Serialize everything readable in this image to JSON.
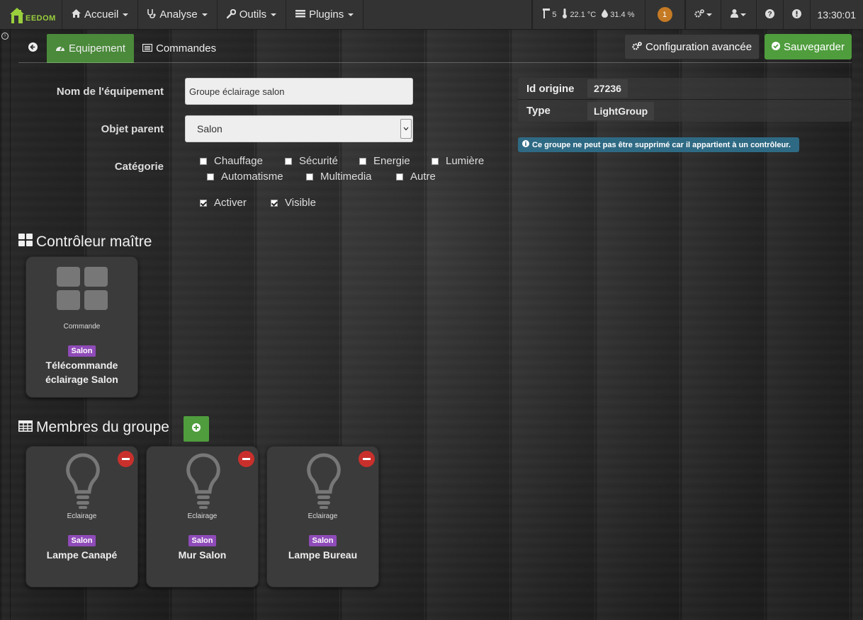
{
  "navbar": {
    "brand": "EEDOM",
    "menu": [
      {
        "label": "Accueil",
        "icon": "home-icon"
      },
      {
        "label": "Analyse",
        "icon": "stethoscope-icon"
      },
      {
        "label": "Outils",
        "icon": "wrench-icon"
      },
      {
        "label": "Plugins",
        "icon": "tasks-icon"
      }
    ],
    "status": {
      "doors": "5",
      "temperature": "22.1 °C",
      "humidity": "31.4 %"
    },
    "notifications": "1",
    "clock": "13:30:01"
  },
  "tabs": {
    "equipment": "Equipement",
    "commands": "Commandes"
  },
  "actions": {
    "advanced": "Configuration avancée",
    "save": "Sauvegarder"
  },
  "form": {
    "name_label": "Nom de l'équipement",
    "name_value": "Groupe éclairage salon",
    "parent_label": "Objet parent",
    "parent_value": "Salon",
    "category_label": "Catégorie",
    "categories": [
      {
        "label": "Chauffage",
        "checked": false
      },
      {
        "label": "Sécurité",
        "checked": false
      },
      {
        "label": "Energie",
        "checked": false
      },
      {
        "label": "Lumière",
        "checked": false
      },
      {
        "label": "Automatisme",
        "checked": false
      },
      {
        "label": "Multimedia",
        "checked": false
      },
      {
        "label": "Autre",
        "checked": false
      }
    ],
    "activate_label": "Activer",
    "visible_label": "Visible"
  },
  "info": {
    "id_label": "Id origine",
    "id_value": "27236",
    "type_label": "Type",
    "type_value": "LightGroup",
    "notice": "Ce groupe ne peut pas être supprimé car il appartient à un contrôleur."
  },
  "master": {
    "title": "Contrôleur maître",
    "card": {
      "type": "Commande",
      "room": "Salon",
      "name": "Télécommande éclairage Salon"
    }
  },
  "members": {
    "title": "Membres du groupe",
    "cards": [
      {
        "type": "Eclairage",
        "room": "Salon",
        "name": "Lampe Canapé"
      },
      {
        "type": "Eclairage",
        "room": "Salon",
        "name": "Mur Salon"
      },
      {
        "type": "Eclairage",
        "room": "Salon",
        "name": "Lampe Bureau"
      }
    ]
  },
  "colors": {
    "accent_green": "#4f9d3d",
    "room_badge": "#8f4bb8",
    "remove_red": "#c9302c",
    "notice_blue": "#2f6a84"
  }
}
